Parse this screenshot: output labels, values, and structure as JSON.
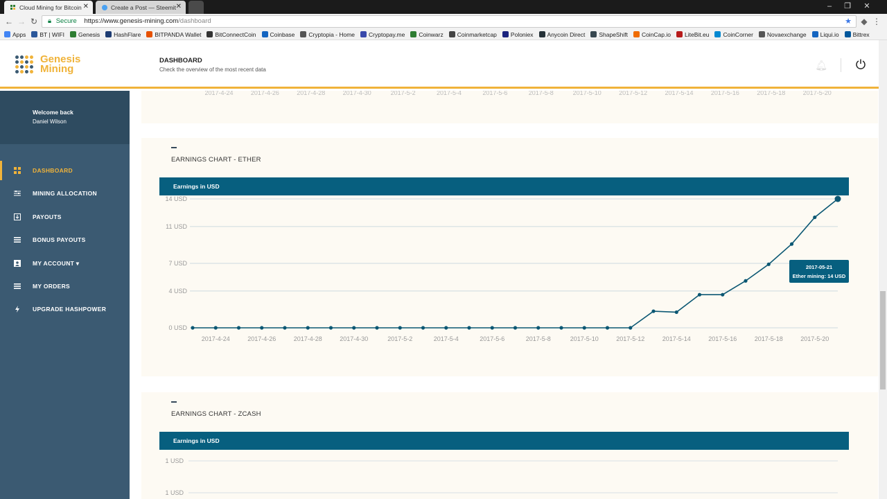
{
  "browser": {
    "tabs": [
      {
        "title": "Cloud Mining for Bitcoin",
        "active": true
      },
      {
        "title": "Create a Post — Steemit",
        "active": false
      }
    ],
    "address": {
      "secure_label": "Secure",
      "url_domain": "https://www.genesis-mining.com",
      "url_path": "/dashboard"
    },
    "bookmarks": [
      "Apps",
      "BT | WIFI",
      "Genesis",
      "HashFlare",
      "BITPANDA Wallet",
      "BitConnectCoin",
      "Coinbase",
      "Cryptopia - Home",
      "Cryptopay.me",
      "Coinwarz",
      "Coinmarketcap",
      "Poloniex",
      "Anycoin Direct",
      "ShapeShift",
      "CoinCap.io",
      "LiteBit.eu",
      "CoinCorner",
      "Novaexchange",
      "Liqui.io",
      "Bittrex"
    ]
  },
  "header": {
    "logo_line1": "Genesis",
    "logo_line2": "Mining",
    "title": "DASHBOARD",
    "subtitle": "Check the overview of the most recent data"
  },
  "sidebar": {
    "welcome": "Welcome back",
    "user": "Daniel Wilson",
    "items": [
      {
        "label": "DASHBOARD",
        "icon": "dashboard-icon",
        "active": true
      },
      {
        "label": "MINING ALLOCATION",
        "icon": "sliders-icon",
        "active": false
      },
      {
        "label": "PAYOUTS",
        "icon": "download-icon",
        "active": false
      },
      {
        "label": "BONUS PAYOUTS",
        "icon": "list-icon",
        "active": false
      },
      {
        "label": "MY ACCOUNT ▾",
        "icon": "account-icon",
        "active": false
      },
      {
        "label": "MY ORDERS",
        "icon": "list-icon",
        "active": false
      },
      {
        "label": "UPGRADE HASHPOWER",
        "icon": "bolt-icon",
        "active": false
      }
    ]
  },
  "previous_chart": {
    "x_ticks": [
      "2017-4-24",
      "2017-4-26",
      "2017-4-28",
      "2017-4-30",
      "2017-5-2",
      "2017-5-4",
      "2017-5-6",
      "2017-5-8",
      "2017-5-10",
      "2017-5-12",
      "2017-5-14",
      "2017-5-16",
      "2017-5-18",
      "2017-5-20"
    ]
  },
  "ether_card": {
    "title": "EARNINGS CHART - ETHER",
    "bar_label": "Earnings in USD",
    "tooltip_date": "2017-05-21",
    "tooltip_value": "Ether mining: 14 USD"
  },
  "zcash_card": {
    "title": "EARNINGS CHART - ZCASH",
    "bar_label": "Earnings in USD",
    "y_ticks": [
      "1 USD",
      "1 USD"
    ]
  },
  "chart_data": {
    "type": "line",
    "title": "Earnings in USD",
    "ylabel": "",
    "xlabel": "",
    "ylim": [
      0,
      14
    ],
    "y_ticks": [
      "0 USD",
      "4 USD",
      "7 USD",
      "11 USD",
      "14 USD"
    ],
    "y_tick_values": [
      0,
      4,
      7,
      11,
      14
    ],
    "x_ticks": [
      "2017-4-24",
      "2017-4-26",
      "2017-4-28",
      "2017-4-30",
      "2017-5-2",
      "2017-5-4",
      "2017-5-6",
      "2017-5-8",
      "2017-5-10",
      "2017-5-12",
      "2017-5-14",
      "2017-5-16",
      "2017-5-18",
      "2017-5-20"
    ],
    "x": [
      "2017-4-23",
      "2017-4-24",
      "2017-4-25",
      "2017-4-26",
      "2017-4-27",
      "2017-4-28",
      "2017-4-29",
      "2017-4-30",
      "2017-5-1",
      "2017-5-2",
      "2017-5-3",
      "2017-5-4",
      "2017-5-5",
      "2017-5-6",
      "2017-5-7",
      "2017-5-8",
      "2017-5-9",
      "2017-5-10",
      "2017-5-11",
      "2017-5-12",
      "2017-5-13",
      "2017-5-14",
      "2017-5-15",
      "2017-5-16",
      "2017-5-17",
      "2017-5-18",
      "2017-5-19",
      "2017-5-20",
      "2017-5-21"
    ],
    "series": [
      {
        "name": "Ether mining",
        "values": [
          0,
          0,
          0,
          0,
          0,
          0,
          0,
          0,
          0,
          0,
          0,
          0,
          0,
          0,
          0,
          0,
          0,
          0,
          0,
          0,
          1.8,
          1.7,
          3.6,
          3.6,
          5.1,
          6.9,
          9.1,
          12.0,
          14.0
        ]
      }
    ],
    "grid": true,
    "line_color": "#0b5773"
  }
}
